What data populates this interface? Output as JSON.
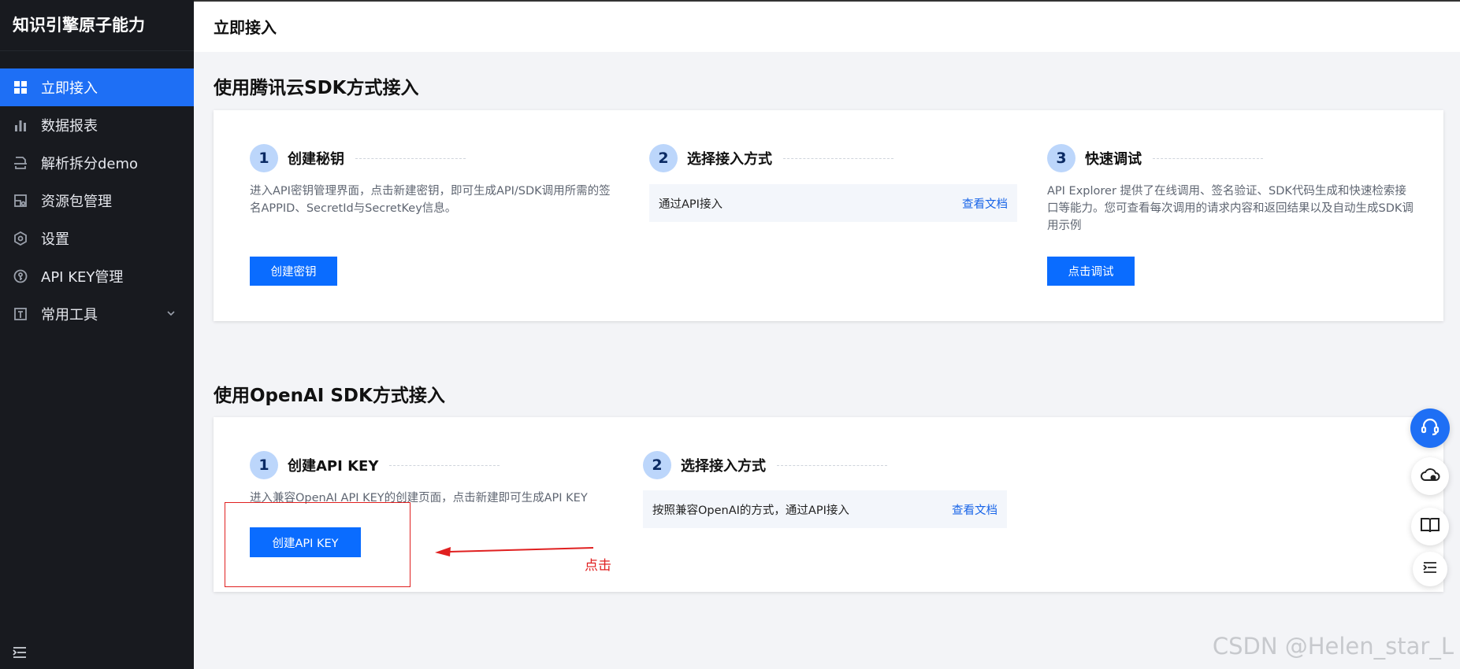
{
  "sidebar": {
    "brand": "知识引擎原子能力",
    "items": [
      {
        "label": "立即接入",
        "icon": "grid-icon",
        "active": true
      },
      {
        "label": "数据报表",
        "icon": "bar-chart-icon"
      },
      {
        "label": "解析拆分demo",
        "icon": "split-icon"
      },
      {
        "label": "资源包管理",
        "icon": "package-icon"
      },
      {
        "label": "设置",
        "icon": "gear-icon"
      },
      {
        "label": "API KEY管理",
        "icon": "key-icon"
      },
      {
        "label": "常用工具",
        "icon": "tools-icon",
        "has_submenu": true
      }
    ]
  },
  "header": {
    "title": "立即接入"
  },
  "sdk_section": {
    "title": "使用腾讯云SDK方式接入",
    "steps": [
      {
        "num": "1",
        "title": "创建秘钥",
        "desc": "进入API密钥管理界面，点击新建密钥，即可生成API/SDK调用所需的签名APPID、SecretId与SecretKey信息。",
        "button": "创建密钥"
      },
      {
        "num": "2",
        "title": "选择接入方式",
        "method_label": "通过API接入",
        "method_link": "查看文档"
      },
      {
        "num": "3",
        "title": "快速调试",
        "desc": "API Explorer 提供了在线调用、签名验证、SDK代码生成和快速检索接口等能力。您可查看每次调用的请求内容和返回结果以及自动生成SDK调用示例",
        "button": "点击调试"
      }
    ]
  },
  "openai_section": {
    "title": "使用OpenAI SDK方式接入",
    "steps": [
      {
        "num": "1",
        "title": "创建API KEY",
        "desc": "进入兼容OpenAI API KEY的创建页面，点击新建即可生成API KEY",
        "button": "创建API KEY"
      },
      {
        "num": "2",
        "title": "选择接入方式",
        "method_label": "按照兼容OpenAI的方式，通过API接入",
        "method_link": "查看文档"
      }
    ]
  },
  "annotation": {
    "text": "点击",
    "color": "#e02020"
  },
  "floating_tools": [
    "headset-icon",
    "cloud-icon",
    "book-icon",
    "list-icon"
  ],
  "watermark": "CSDN @Helen_star_L",
  "colors": {
    "accent": "#1e6ff5",
    "button": "#0a6cff",
    "sidebar_bg": "#181a1f",
    "step_badge": "#bcd6fb"
  }
}
